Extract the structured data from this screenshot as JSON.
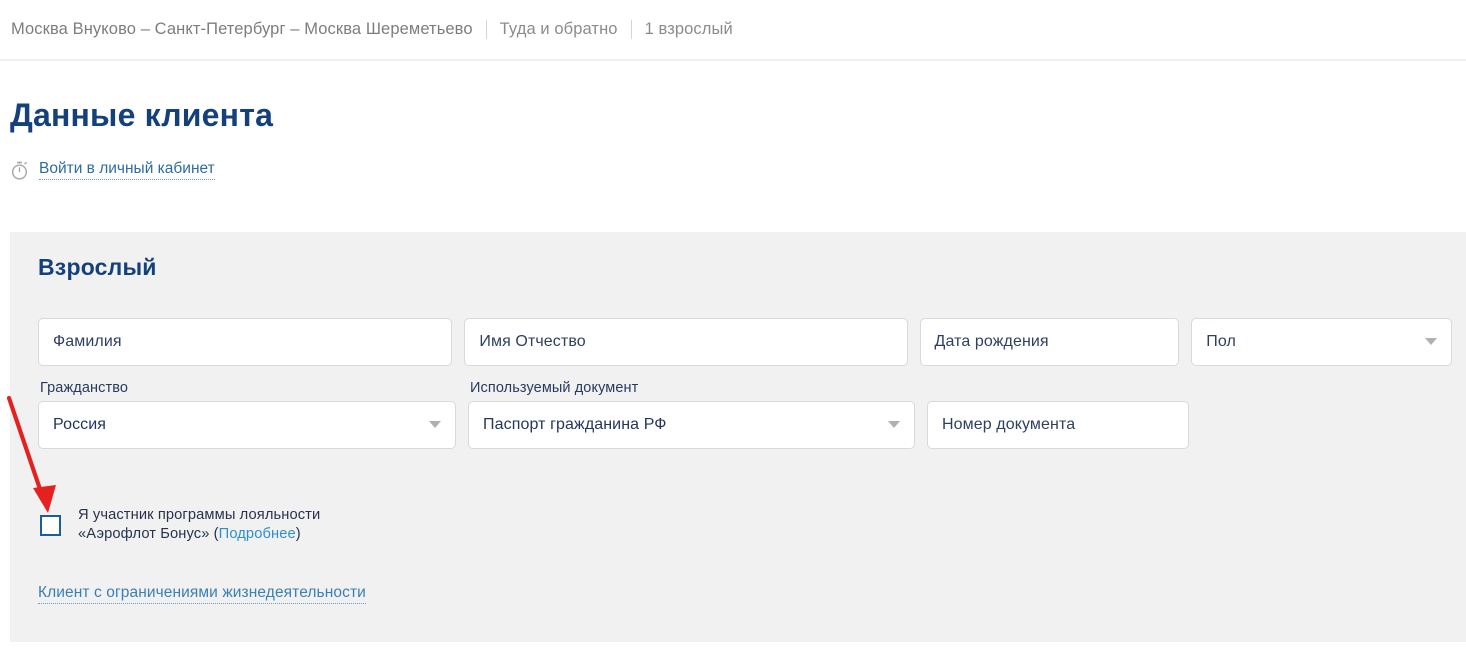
{
  "topbar": {
    "route": "Москва Внуково – Санкт-Петербург – Москва Шереметьево",
    "trip_type": "Туда и обратно",
    "passengers": "1 взрослый"
  },
  "page": {
    "title": "Данные клиента",
    "login_icon": "stopwatch-icon",
    "login_link": "Войти в личный кабинет"
  },
  "panel": {
    "title": "Взрослый",
    "fields": {
      "surname": {
        "placeholder": "Фамилия",
        "value": ""
      },
      "firstname": {
        "placeholder": "Имя Отчество",
        "value": ""
      },
      "birthdate": {
        "placeholder": "Дата рождения",
        "value": ""
      },
      "gender": {
        "placeholder": "Пол",
        "value": "",
        "caret_icon": "chevron-down-icon"
      },
      "citizenship": {
        "label": "Гражданство",
        "value": "Россия",
        "caret_icon": "chevron-down-icon"
      },
      "document_type": {
        "label": "Используемый документ",
        "value": "Паспорт гражданина РФ",
        "caret_icon": "chevron-down-icon"
      },
      "document_number": {
        "placeholder": "Номер документа",
        "value": ""
      }
    },
    "loyalty": {
      "checked": false,
      "line1": "Я участник программы лояльности",
      "line2_prefix": "«Аэрофлот Бонус» (",
      "link": "Подробнее",
      "line2_suffix": ")"
    },
    "disability_link": "Клиент с ограничениями жизнедеятельности"
  },
  "annotation": {
    "arrow_color": "#e52020",
    "points_to": "loyalty-checkbox"
  },
  "colors": {
    "brand_blue": "#14417c",
    "link_blue": "#2e8fd0",
    "panel_bg": "#f1f1f1",
    "field_border": "#d9d9d9",
    "page_bg": "#ffffff"
  }
}
